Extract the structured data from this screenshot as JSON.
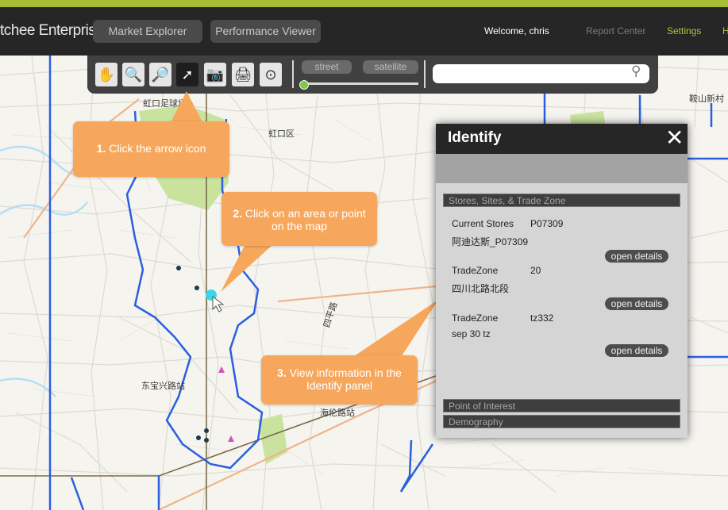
{
  "header": {
    "brand": "tchee Enterprise",
    "brand_mark": "®",
    "nav": [
      "Market Explorer",
      "Performance Viewer"
    ],
    "welcome": "Welcome, chris",
    "links": [
      "Report Center",
      "Settings",
      "H"
    ]
  },
  "toolbar": {
    "tools": [
      "hand-icon",
      "zoom-in-icon",
      "zoom-out-icon",
      "arrow-icon",
      "camera-icon",
      "print-icon",
      "location-pin-icon"
    ],
    "active_tool": "arrow-icon",
    "map_types": [
      "street",
      "satellite"
    ],
    "search_placeholder": ""
  },
  "map": {
    "labels": [
      "虹口足球场",
      "虹口区",
      "四平路",
      "东宝兴路站",
      "海伦路站",
      "鞍山新村"
    ]
  },
  "callouts": [
    {
      "step": "1.",
      "text": " Click the arrow icon"
    },
    {
      "step": "2.",
      "text": " Click on an area or point on the map"
    },
    {
      "step": "3.",
      "text": " View information in the Identify panel"
    }
  ],
  "identify": {
    "title": "Identify",
    "section_stores": "Stores, Sites, & Trade Zone",
    "records": [
      {
        "label": "Current Stores",
        "value": "P07309",
        "sub": "阿迪达斯_P07309",
        "button": "open details"
      },
      {
        "label": "TradeZone",
        "value": "20",
        "sub": "四川北路北段",
        "button": "open details"
      },
      {
        "label": "TradeZone",
        "value": "tz332",
        "sub": "sep 30 tz",
        "button": "open details"
      }
    ],
    "section_poi": "Point of Interest",
    "section_demo": "Demography"
  },
  "colors": {
    "accent_green": "#a7bd35",
    "callout_orange": "#f7a75c",
    "zone_blue": "#2a5fe0",
    "selected_point": "#3dd6e8"
  }
}
